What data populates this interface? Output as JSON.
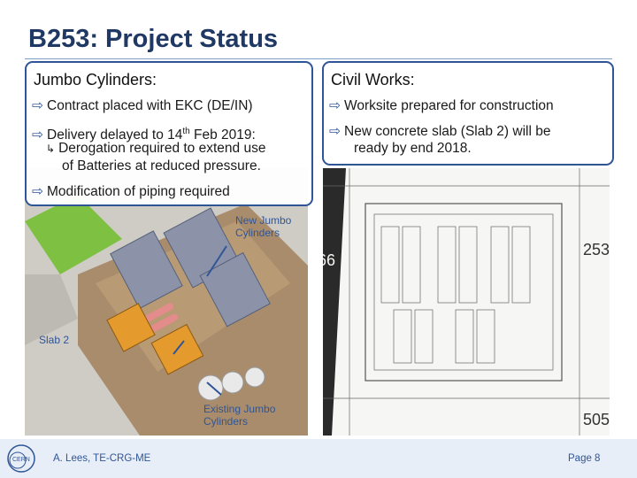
{
  "slide": {
    "title": "B253: Project Status"
  },
  "left_box": {
    "heading": "Jumbo Cylinders:",
    "bullet1": "Contract placed with EKC (DE/IN)",
    "bullet2_pre": "Delivery delayed to 14",
    "bullet2_sup": "th",
    "bullet2_post": " Feb 2019:",
    "sub1": "Derogation required to extend use",
    "sub2": "of Batteries at reduced pressure.",
    "bullet3": "Modification of piping required"
  },
  "right_box": {
    "heading": "Civil Works:",
    "bullet1": "Worksite prepared for construction",
    "bullet2a": "New concrete slab (Slab 2) will be",
    "bullet2b": "ready by end 2018."
  },
  "callouts": {
    "new_jumbo_1": "New Jumbo",
    "new_jumbo_2": "Cylinders",
    "slab": "Slab 2",
    "existing_1": "Existing Jumbo",
    "existing_2": "Cylinders"
  },
  "plan_labels": {
    "building_a": "253",
    "building_b": "505",
    "building_c": "66"
  },
  "footer": {
    "author": "A. Lees, TE-CRG-ME",
    "page": "Page 8",
    "logo_text": "CERN"
  },
  "colors": {
    "accent": "#2f5597",
    "title": "#1f3864",
    "footer_bg": "#e8eef7"
  },
  "icons": {
    "bullet": "arrow-right-outline-icon",
    "sub_bullet": "return-arrow-icon"
  }
}
